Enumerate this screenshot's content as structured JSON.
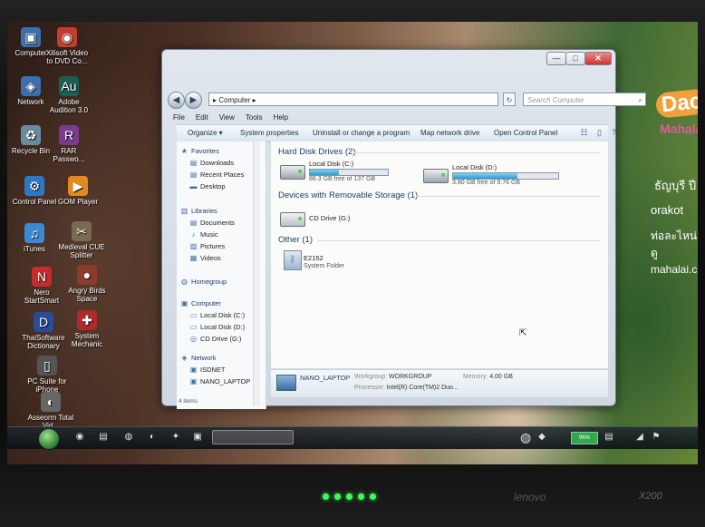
{
  "desktop": {
    "icons": [
      {
        "label": "Computer",
        "glyph": "▣",
        "color": "#3b6fb0"
      },
      {
        "label": "Xilisoft Video to DVD Co...",
        "glyph": "◉",
        "color": "#c23d2d"
      },
      {
        "label": "Network",
        "glyph": "◈",
        "color": "#3b6fb0"
      },
      {
        "label": "Adobe Audition 3.0",
        "glyph": "Au",
        "color": "#1d5d52"
      },
      {
        "label": "Recycle Bin",
        "glyph": "♻",
        "color": "#6a8aa0"
      },
      {
        "label": "RAR Passwo...",
        "glyph": "R",
        "color": "#7a3b8e"
      },
      {
        "label": "Control Panel",
        "glyph": "⚙",
        "color": "#2e77c4"
      },
      {
        "label": "GOM Player",
        "glyph": "▶",
        "color": "#e28a1f"
      },
      {
        "label": "iTunes",
        "glyph": "♫",
        "color": "#3a8ad6"
      },
      {
        "label": "Medieval CUE Splitter",
        "glyph": "✂",
        "color": "#7a6a50"
      },
      {
        "label": "Nero StartSmart",
        "glyph": "N",
        "color": "#c72b2b"
      },
      {
        "label": "Angry Birds Space",
        "glyph": "●",
        "color": "#8a3b2b"
      },
      {
        "label": "ThaiSoftware Dictionary",
        "glyph": "D",
        "color": "#2a4a9a"
      },
      {
        "label": "System Mechanic",
        "glyph": "✚",
        "color": "#b02a2a"
      },
      {
        "label": "PC Suite for iPhone",
        "glyph": "▯",
        "color": "#555555"
      },
      {
        "label": "Asseorm Total Vid...",
        "glyph": "◐",
        "color": "#666666"
      }
    ],
    "ad": {
      "dao": "Dao",
      "mahalai": "Mahalai.com",
      "line1": "ธัญบุรี ปี",
      "line2": "orakot",
      "line3": "ท่อละไหน่ดู",
      "line4": "mahalai.com"
    }
  },
  "window": {
    "controls": {
      "minimize": "—",
      "maximize": "□",
      "close": "✕"
    },
    "address": {
      "path": "▸ Computer ▸",
      "refresh": "↻",
      "search_placeholder": "Search Computer",
      "search_icon": "⌕"
    },
    "nav": {
      "back": "◀",
      "forward": "▶"
    },
    "menu": [
      "File",
      "Edit",
      "View",
      "Tools",
      "Help"
    ],
    "commands": {
      "organize": "Organize ▾",
      "system_properties": "System properties",
      "uninstall": "Uninstall or change a program",
      "map_drive": "Map network drive",
      "control_panel": "Open Control Panel"
    },
    "nav_pane": {
      "favorites": "Favorites",
      "downloads": "Downloads",
      "recent": "Recent Places",
      "desktop": "Desktop",
      "libraries": "Libraries",
      "documents": "Documents",
      "music": "Music",
      "pictures": "Pictures",
      "videos": "Videos",
      "homegroup": "Homegroup",
      "computer": "Computer",
      "local_c": "Local Disk (C:)",
      "local_d": "Local Disk (D:)",
      "cd": "CD Drive (G:)",
      "network": "Network",
      "isdnet": "ISDNET",
      "nano": "NANO_LAPTOP"
    },
    "groups": {
      "hdd": "Hard Disk Drives (2)",
      "removable": "Devices with Removable Storage (1)",
      "other": "Other (1)"
    },
    "drives": [
      {
        "name": "Local Disk (C:)",
        "free": "86.3 GB free of 137 GB",
        "used_fraction": 0.37
      },
      {
        "name": "Local Disk (D:)",
        "free": "3.80 GB free of 9.76 GB",
        "used_fraction": 0.61
      }
    ],
    "cd": {
      "name": "CD Drive (G:)"
    },
    "other": {
      "name": "E2152",
      "type": "System Folder"
    },
    "details": {
      "computer_name": "NANO_LAPTOP",
      "workgroup_label": "Workgroup:",
      "workgroup": "WORKGROUP",
      "memory_label": "Memory:",
      "memory": "4.00 GB",
      "processor_label": "Processor:",
      "processor": "Intel(R) Core(TM)2 Duo..."
    },
    "status": "4 items"
  },
  "taskbar": {
    "battery": "96%"
  },
  "laptop": {
    "brand": "lenovo",
    "model": "X200"
  }
}
